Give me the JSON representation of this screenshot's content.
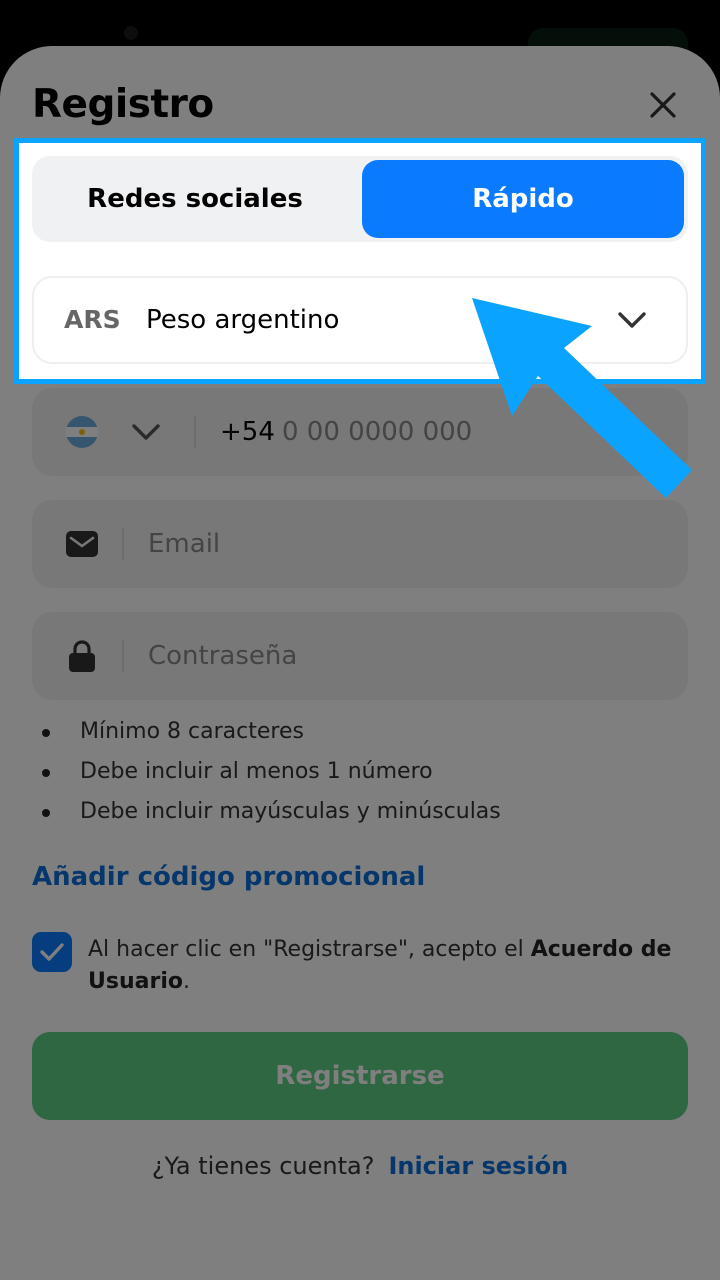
{
  "header": {
    "title": "Registro",
    "close_icon": "close-icon"
  },
  "tabs": [
    {
      "label": "Redes sociales",
      "active": false
    },
    {
      "label": "Rápido",
      "active": true
    }
  ],
  "currency": {
    "code": "ARS",
    "name": "Peso argentino"
  },
  "phone": {
    "country_flag": "argentina-flag-icon",
    "prefix": "+54",
    "placeholder": "0 00 0000 000"
  },
  "email": {
    "placeholder": "Email"
  },
  "password": {
    "placeholder": "Contraseña"
  },
  "password_rules": [
    "Mínimo 8 caracteres",
    "Debe incluir al menos 1 número",
    "Debe incluir mayúsculas y minúsculas"
  ],
  "promo_link": "Añadir código promocional",
  "agreement": {
    "checked": true,
    "text": "Al hacer clic en \"Registrarse\", acepto el ",
    "link": "Acuerdo de Usuario",
    "suffix": "."
  },
  "register_button": "Registrarse",
  "login": {
    "prompt": "¿Ya tienes cuenta?",
    "link": "Iniciar sesión"
  },
  "colors": {
    "accent": "#0a7bff",
    "link": "#0a6fd8",
    "register_button": "#5ecf85",
    "highlight": "#0aa3ff"
  }
}
